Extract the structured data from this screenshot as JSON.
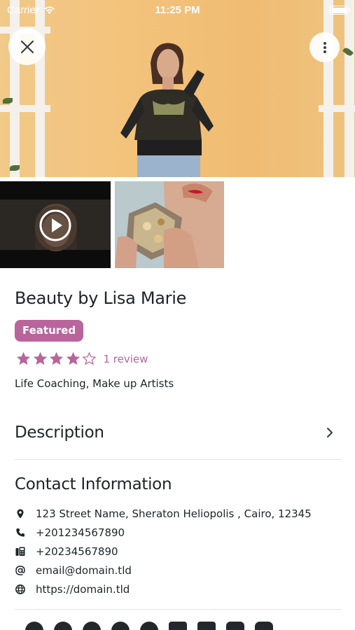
{
  "status_bar": {
    "carrier": "Carrier",
    "time": "11:25 PM"
  },
  "hero": {
    "close_icon": "close-icon",
    "more_icon": "more-vertical-icon"
  },
  "gallery": [
    {
      "type": "video",
      "icon": "play-icon"
    },
    {
      "type": "photo"
    }
  ],
  "listing": {
    "title": "Beauty by Lisa Marie",
    "badge": "Featured",
    "rating": 4,
    "rating_max": 5,
    "review_text": "1 review",
    "categories": "Life Coaching, Make up Artists"
  },
  "description": {
    "label": "Description",
    "icon": "chevron-right-icon"
  },
  "contact": {
    "title": "Contact Information",
    "items": [
      {
        "icon": "location-pin-icon",
        "text": "123 Street Name, Sheraton Heliopolis , Cairo, 12345"
      },
      {
        "icon": "phone-icon",
        "text": "+201234567890"
      },
      {
        "icon": "fax-icon",
        "text": "+20234567890"
      },
      {
        "icon": "at-icon",
        "text": "email@domain.tld"
      },
      {
        "icon": "globe-icon",
        "text": "https://domain.tld"
      }
    ]
  },
  "social": [
    "facebook-icon",
    "twitter-icon",
    "whatsapp-icon",
    "pinterest-icon",
    "tumblr-icon",
    "linkedin-icon",
    "email-icon",
    "youtube-icon",
    "instagram-icon"
  ],
  "colors": {
    "accent": "#b9649b",
    "text": "#1e2328",
    "divider": "#e1e3e6",
    "hero_wall": "#f0bc73"
  }
}
